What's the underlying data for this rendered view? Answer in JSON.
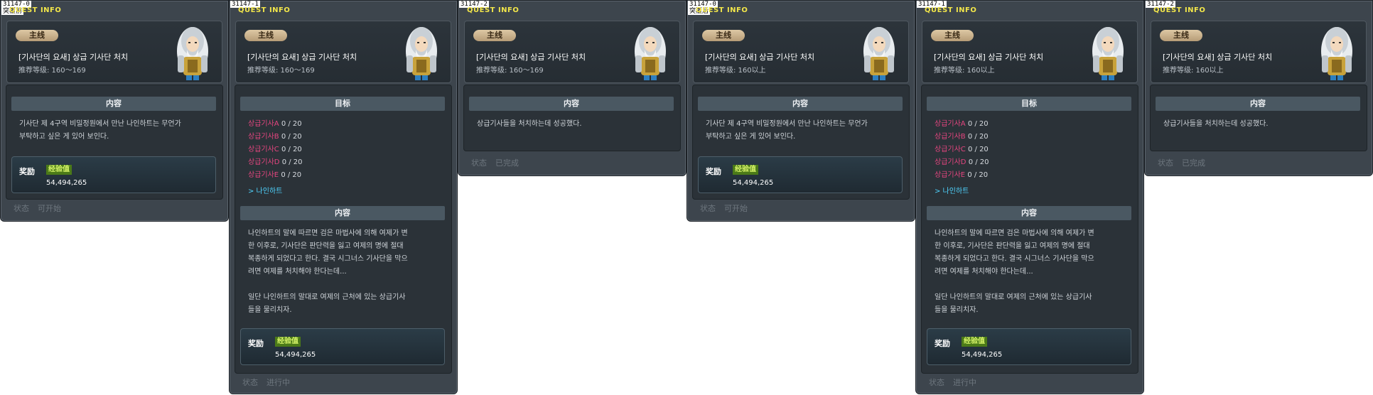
{
  "panels": [
    {
      "id": "31147-0",
      "note": "突覆前",
      "label": "QUEST INFO",
      "badge": "主线",
      "title": "[기사단의 요새] 상급 기사단 처치",
      "level": "推荐等级: 160～169",
      "content_header": "内容",
      "content_text": "기사단 제 4구역 비밀정원에서 만난 나인하트는 무언가\n부탁하고 싶은 게 있어 보인다.",
      "reward_label": "奖励",
      "reward_type": "经验值",
      "reward_value": "54,494,265",
      "status_label": "状态",
      "status_value": "可开始"
    },
    {
      "id": "31147-1",
      "label": "QUEST INFO",
      "badge": "主线",
      "title": "[기사단의 요새] 상급 기사단 처치",
      "level": "推荐等级: 160～169",
      "goal_header": "目标",
      "goals": [
        {
          "mob": "상급기사A",
          "count": "0 / 20"
        },
        {
          "mob": "상급기사B",
          "count": "0 / 20"
        },
        {
          "mob": "상급기사C",
          "count": "0 / 20"
        },
        {
          "mob": "상급기사D",
          "count": "0 / 20"
        },
        {
          "mob": "상급기사E",
          "count": "0 / 20"
        }
      ],
      "npc_link": "> 나인하트",
      "content_header": "内容",
      "content_text": "나인하트의 말에 따르면 검은 마법사에 의해 여제가 변\n한 이후로, 기사단은 판단력을 잃고 여제의 명에 절대\n복종하게 되었다고 한다. 결국 시그너스 기사단을 막으\n려면 여제를 처치해야 한다는데...\n\n일단 나인하트의 말대로 여제의 근처에 있는 상급기사\n들을 물리치자.",
      "reward_label": "奖励",
      "reward_type": "经验值",
      "reward_value": "54,494,265",
      "status_label": "状态",
      "status_value": "进行中"
    },
    {
      "id": "31147-2",
      "label": "QUEST INFO",
      "badge": "主线",
      "title": "[기사단의 요새] 상급 기사단 처치",
      "level": "推荐等级: 160～169",
      "content_header": "内容",
      "content_text": "상급기사들을 처치하는데 성공했다.",
      "status_label": "状态",
      "status_value": "已完成"
    },
    {
      "id": "31147-0",
      "note": "突覆后",
      "label": "QUEST INFO",
      "badge": "主线",
      "title": "[기사단의 요새] 상급 기사단 처치",
      "level": "推荐等级: 160以上",
      "content_header": "内容",
      "content_text": "기사단 제 4구역 비밀정원에서 만난 나인하트는 무언가\n부탁하고 싶은 게 있어 보인다.",
      "reward_label": "奖励",
      "reward_type": "经验值",
      "reward_value": "54,494,265",
      "status_label": "状态",
      "status_value": "可开始"
    },
    {
      "id": "31147-1",
      "label": "QUEST INFO",
      "badge": "主线",
      "title": "[기사단의 요새] 상급 기사단 처치",
      "level": "推荐等级: 160以上",
      "goal_header": "目标",
      "goals": [
        {
          "mob": "상급기사A",
          "count": "0 / 20"
        },
        {
          "mob": "상급기사B",
          "count": "0 / 20"
        },
        {
          "mob": "상급기사C",
          "count": "0 / 20"
        },
        {
          "mob": "상급기사D",
          "count": "0 / 20"
        },
        {
          "mob": "상급기사E",
          "count": "0 / 20"
        }
      ],
      "npc_link": "> 나인하트",
      "content_header": "内容",
      "content_text": "나인하트의 말에 따르면 검은 마법사에 의해 여제가 변\n한 이후로, 기사단은 판단력을 잃고 여제의 명에 절대\n복종하게 되었다고 한다. 결국 시그너스 기사단을 막으\n려면 여제를 처치해야 한다는데...\n\n일단 나인하트의 말대로 여제의 근처에 있는 상급기사\n들을 물리치자.",
      "reward_label": "奖励",
      "reward_type": "经验值",
      "reward_value": "54,494,265",
      "status_label": "状态",
      "status_value": "进行中"
    },
    {
      "id": "31147-2",
      "label": "QUEST INFO",
      "badge": "主线",
      "title": "[기사단의 요새] 상급 기사단 처치",
      "level": "推荐等级: 160以上",
      "content_header": "内容",
      "content_text": "상급기사들을 처치하는데 성공했다.",
      "status_label": "状态",
      "status_value": "已完成"
    }
  ]
}
